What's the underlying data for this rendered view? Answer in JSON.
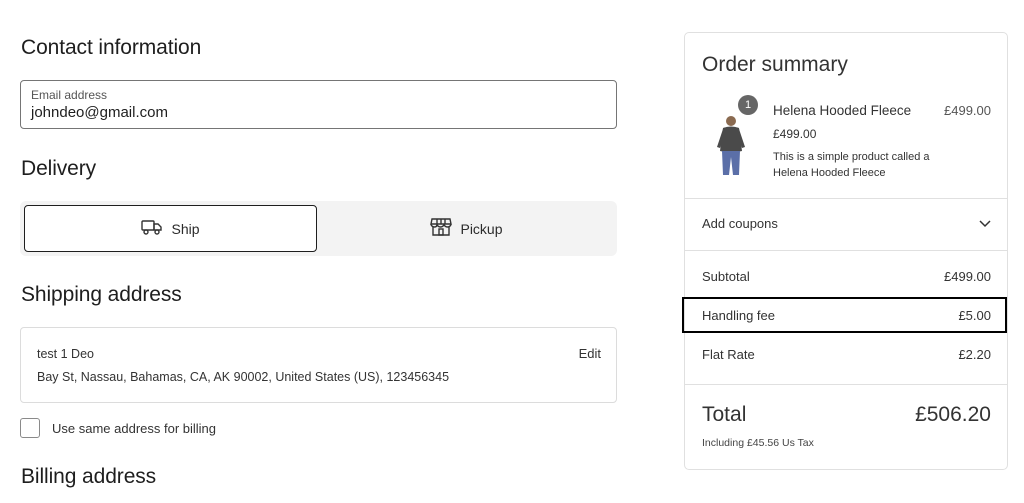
{
  "contact": {
    "heading": "Contact information",
    "email_label": "Email address",
    "email_value": "johndeo@gmail.com"
  },
  "delivery": {
    "heading": "Delivery",
    "options": [
      {
        "label": "Ship",
        "icon": "truck-icon",
        "selected": true
      },
      {
        "label": "Pickup",
        "icon": "store-icon",
        "selected": false
      }
    ]
  },
  "shipping": {
    "heading": "Shipping address",
    "name": "test 1 Deo",
    "address": "Bay St, Nassau, Bahamas, CA, AK 90002, United States (US), 123456345",
    "edit_label": "Edit"
  },
  "billing_checkbox": {
    "label": "Use same address for billing",
    "checked": false
  },
  "billing": {
    "heading": "Billing address"
  },
  "summary": {
    "title": "Order summary",
    "product": {
      "quantity": "1",
      "name": "Helena Hooded Fleece",
      "line_total": "£499.00",
      "price": "£499.00",
      "description": "This is a simple product called a Helena Hooded Fleece"
    },
    "coupons_label": "Add coupons",
    "lines": [
      {
        "label": "Subtotal",
        "value": "£499.00"
      },
      {
        "label": "Handling fee",
        "value": "£5.00"
      },
      {
        "label": "Flat Rate",
        "value": "£2.20"
      }
    ],
    "total_label": "Total",
    "total_value": "£506.20",
    "tax_note": "Including £45.56 Us Tax"
  },
  "colors": {
    "text": "#1e1e1e",
    "border": "#e0e0e0",
    "highlight": "#000000",
    "toggle_bg": "#f3f3f3"
  }
}
